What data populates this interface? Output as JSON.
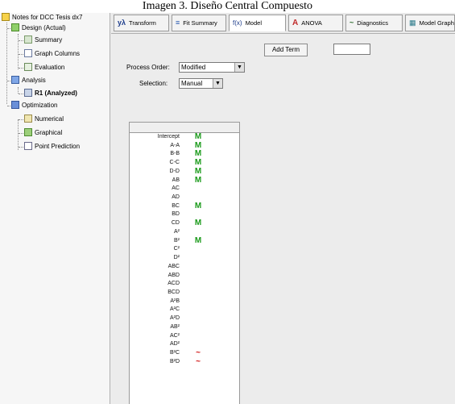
{
  "caption": "Imagen 3. Diseño Central Compuesto",
  "tree": {
    "items": [
      {
        "label": "Notes for DCC Tesis dx7",
        "icon": "notes-icon",
        "bold": false
      },
      {
        "label": "Design (Actual)",
        "icon": "design-icon",
        "bold": false
      },
      {
        "label": "Summary",
        "icon": "summary-icon",
        "bold": false
      },
      {
        "label": "Graph Columns",
        "icon": "graph-columns-icon",
        "bold": false
      },
      {
        "label": "Evaluation",
        "icon": "evaluation-icon",
        "bold": false
      },
      {
        "label": "Analysis",
        "icon": "analysis-icon",
        "bold": false
      },
      {
        "label": "R1 (Analyzed)",
        "icon": "response-icon",
        "bold": true
      },
      {
        "label": "Optimization",
        "icon": "optimization-icon",
        "bold": false
      },
      {
        "label": "Numerical",
        "icon": "numerical-icon",
        "bold": false
      },
      {
        "label": "Graphical",
        "icon": "graphical-icon",
        "bold": false
      },
      {
        "label": "Point Prediction",
        "icon": "point-prediction-icon",
        "bold": false
      }
    ]
  },
  "tabs": [
    {
      "label": "Transform",
      "icon_text": "yλ"
    },
    {
      "label": "Fit Summary",
      "icon_text": "≡"
    },
    {
      "label": "Model",
      "icon_text": "f(x)"
    },
    {
      "label": "ANOVA",
      "icon_text": "A"
    },
    {
      "label": "Diagnostics",
      "icon_text": "~"
    },
    {
      "label": "Model Graphs",
      "icon_text": "▦"
    }
  ],
  "controls": {
    "process_order_label": "Process Order:",
    "process_order_value": "Modified",
    "selection_label": "Selection:",
    "selection_value": "Manual",
    "add_term_label": "Add Term",
    "add_term_value": ""
  },
  "terms": [
    {
      "term": "Intercept",
      "mark": "M"
    },
    {
      "term": "A-A",
      "mark": "M"
    },
    {
      "term": "B-B",
      "mark": "M"
    },
    {
      "term": "C-C",
      "mark": "M"
    },
    {
      "term": "D-D",
      "mark": "M"
    },
    {
      "term": "AB",
      "mark": "M"
    },
    {
      "term": "AC",
      "mark": ""
    },
    {
      "term": "AD",
      "mark": ""
    },
    {
      "term": "BC",
      "mark": "M"
    },
    {
      "term": "BD",
      "mark": ""
    },
    {
      "term": "CD",
      "mark": "M"
    },
    {
      "term": "A²",
      "mark": ""
    },
    {
      "term": "B²",
      "mark": "M"
    },
    {
      "term": "C²",
      "mark": ""
    },
    {
      "term": "D²",
      "mark": ""
    },
    {
      "term": "ABC",
      "mark": ""
    },
    {
      "term": "ABD",
      "mark": ""
    },
    {
      "term": "ACD",
      "mark": ""
    },
    {
      "term": "BCD",
      "mark": ""
    },
    {
      "term": "A²B",
      "mark": ""
    },
    {
      "term": "A²C",
      "mark": ""
    },
    {
      "term": "A²D",
      "mark": ""
    },
    {
      "term": "AB²",
      "mark": ""
    },
    {
      "term": "AC²",
      "mark": ""
    },
    {
      "term": "AD²",
      "mark": ""
    },
    {
      "term": "B²C",
      "mark": "~"
    },
    {
      "term": "B²D",
      "mark": "~"
    }
  ]
}
